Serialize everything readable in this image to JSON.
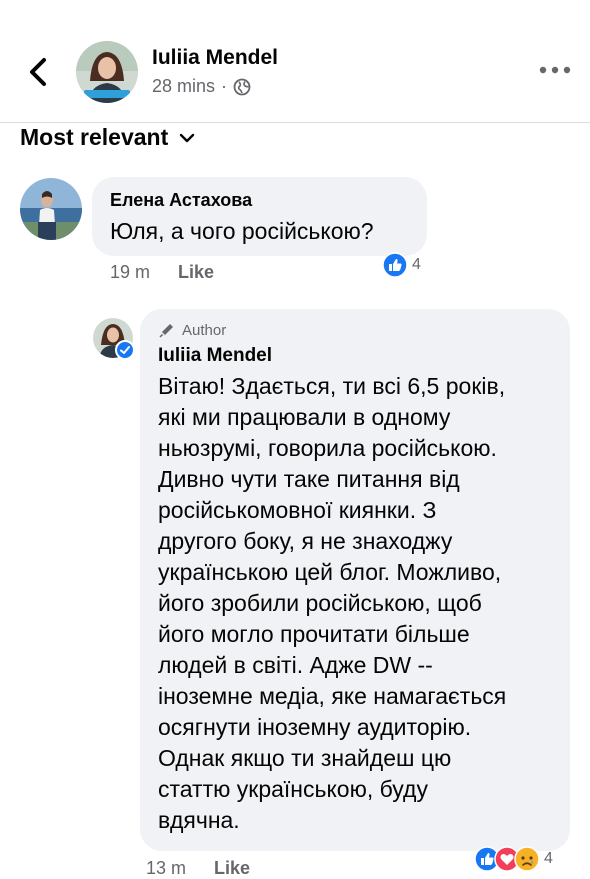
{
  "header": {
    "author_name": "Iuliia Mendel",
    "time": "28 mins",
    "separator": "·",
    "back_icon": "chevron-left-icon",
    "more_icon": "more-horizontal-icon",
    "privacy_icon": "globe-icon"
  },
  "sort": {
    "label": "Most relevant",
    "icon": "chevron-down-icon"
  },
  "comments": [
    {
      "author": "Елена Астахова",
      "text": "Юля, а чого російською?",
      "time": "19 m",
      "like_label": "Like",
      "reactions": {
        "types": [
          "like"
        ],
        "count": "4"
      }
    }
  ],
  "reply": {
    "badge": "Author",
    "badge_icon": "pencil-icon",
    "author": "Iuliia Mendel",
    "text_lines": [
      "Вітаю! Здається, ти всі 6,5 років,",
      "які ми працювали в одному",
      "ньюзрумі, говорила російською.",
      "Дивно чути таке питання від",
      "російськомовної киянки. З",
      "другого боку, я не знаходжу",
      "українською цей блог. Можливо,",
      "його зробили російською, щоб",
      "його могло прочитати більше",
      "людей в світі. Адже DW --",
      "іноземне медіа, яке намагається",
      "осягнути іноземну аудиторію.",
      "Однак якщо ти знайдеш цю",
      "статтю українською, буду",
      "вдячна."
    ],
    "time": "13 m",
    "like_label": "Like",
    "reactions": {
      "types": [
        "like",
        "love",
        "sad"
      ],
      "count": "4"
    }
  },
  "colors": {
    "fb_blue": "#1877f2",
    "love_red": "#f33e58",
    "sad_yellow": "#f7b125",
    "bubble": "#f0f2f5",
    "meta_gray": "#65676b"
  }
}
